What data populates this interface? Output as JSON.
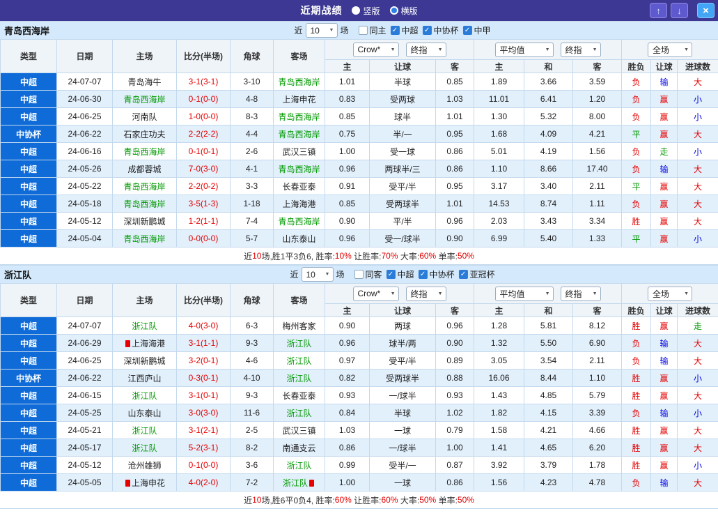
{
  "topbar": {
    "title": "近期战绩",
    "vertical_label": "竖版",
    "vertical_checked": false,
    "horizontal_label": "横版",
    "horizontal_checked": true,
    "up_icon": "↑",
    "down_icon": "↓",
    "close_icon": "×"
  },
  "filter_labels": {
    "near": "近",
    "count": "10",
    "games": "场"
  },
  "table_header": {
    "type": "类型",
    "date": "日期",
    "home": "主场",
    "score": "比分(半场)",
    "corner": "角球",
    "away": "客场",
    "bookmaker": "Crow*",
    "final_index_1": "终指",
    "average": "平均值",
    "final_index_2": "终指",
    "full_match": "全场",
    "sub": [
      "主",
      "让球",
      "客",
      "主",
      "和",
      "客",
      "胜负",
      "让球",
      "进球数"
    ]
  },
  "colors": {
    "topbar": "#3c3894",
    "league": "#0f6bd7",
    "alt": "#e2f0fc",
    "border": "#c3d9ed",
    "headbg": "#eff4f9",
    "section": "#d4e9fb",
    "red": "#e60000",
    "blue": "#0000e0",
    "green": "#009900"
  },
  "sections": [
    {
      "team": "青岛西海岸",
      "checkboxes": [
        {
          "label": "同主",
          "checked": false
        },
        {
          "label": "中超",
          "checked": true
        },
        {
          "label": "中协杯",
          "checked": true
        },
        {
          "label": "中甲",
          "checked": true
        }
      ],
      "rows": [
        {
          "lg": "中超",
          "dt": "24-07-07",
          "hm": "青岛海牛",
          "hg": false,
          "sc": "3-1(3-1)",
          "cn": "3-10",
          "aw": "青岛西海岸",
          "ag": true,
          "o": [
            "1.01",
            "半球",
            "0.85"
          ],
          "a": [
            "1.89",
            "3.66",
            "3.59"
          ],
          "r": [
            [
              "负",
              "red"
            ],
            [
              "输",
              "blue"
            ],
            [
              "大",
              "red"
            ]
          ]
        },
        {
          "lg": "中超",
          "dt": "24-06-30",
          "hm": "青岛西海岸",
          "hg": true,
          "sc": "0-1(0-0)",
          "cn": "4-8",
          "aw": "上海申花",
          "ag": false,
          "o": [
            "0.83",
            "受两球",
            "1.03"
          ],
          "a": [
            "11.01",
            "6.41",
            "1.20"
          ],
          "r": [
            [
              "负",
              "red"
            ],
            [
              "赢",
              "red"
            ],
            [
              "小",
              "blue"
            ]
          ]
        },
        {
          "lg": "中超",
          "dt": "24-06-25",
          "hm": "河南队",
          "hg": false,
          "sc": "1-0(0-0)",
          "cn": "8-3",
          "aw": "青岛西海岸",
          "ag": true,
          "o": [
            "0.85",
            "球半",
            "1.01"
          ],
          "a": [
            "1.30",
            "5.32",
            "8.00"
          ],
          "r": [
            [
              "负",
              "red"
            ],
            [
              "赢",
              "red"
            ],
            [
              "小",
              "blue"
            ]
          ]
        },
        {
          "lg": "中协杯",
          "dt": "24-06-22",
          "hm": "石家庄功夫",
          "hg": false,
          "sc": "2-2(2-2)",
          "cn": "4-4",
          "aw": "青岛西海岸",
          "ag": true,
          "o": [
            "0.75",
            "半/一",
            "0.95"
          ],
          "a": [
            "1.68",
            "4.09",
            "4.21"
          ],
          "r": [
            [
              "平",
              "green"
            ],
            [
              "赢",
              "red"
            ],
            [
              "大",
              "red"
            ]
          ]
        },
        {
          "lg": "中超",
          "dt": "24-06-16",
          "hm": "青岛西海岸",
          "hg": true,
          "sc": "0-1(0-1)",
          "cn": "2-6",
          "aw": "武汉三镇",
          "ag": false,
          "o": [
            "1.00",
            "受一球",
            "0.86"
          ],
          "a": [
            "5.01",
            "4.19",
            "1.56"
          ],
          "r": [
            [
              "负",
              "red"
            ],
            [
              "走",
              "green"
            ],
            [
              "小",
              "blue"
            ]
          ]
        },
        {
          "lg": "中超",
          "dt": "24-05-26",
          "hm": "成都蓉城",
          "hg": false,
          "sc": "7-0(3-0)",
          "cn": "4-1",
          "aw": "青岛西海岸",
          "ag": true,
          "o": [
            "0.96",
            "两球半/三",
            "0.86"
          ],
          "a": [
            "1.10",
            "8.66",
            "17.40"
          ],
          "r": [
            [
              "负",
              "red"
            ],
            [
              "输",
              "blue"
            ],
            [
              "大",
              "red"
            ]
          ]
        },
        {
          "lg": "中超",
          "dt": "24-05-22",
          "hm": "青岛西海岸",
          "hg": true,
          "sc": "2-2(0-2)",
          "cn": "3-3",
          "aw": "长春亚泰",
          "ag": false,
          "o": [
            "0.91",
            "受平/半",
            "0.95"
          ],
          "a": [
            "3.17",
            "3.40",
            "2.11"
          ],
          "r": [
            [
              "平",
              "green"
            ],
            [
              "赢",
              "red"
            ],
            [
              "大",
              "red"
            ]
          ]
        },
        {
          "lg": "中超",
          "dt": "24-05-18",
          "hm": "青岛西海岸",
          "hg": true,
          "sc": "3-5(1-3)",
          "cn": "1-18",
          "aw": "上海海港",
          "ag": false,
          "o": [
            "0.85",
            "受两球半",
            "1.01"
          ],
          "a": [
            "14.53",
            "8.74",
            "1.11"
          ],
          "r": [
            [
              "负",
              "red"
            ],
            [
              "赢",
              "red"
            ],
            [
              "大",
              "red"
            ]
          ]
        },
        {
          "lg": "中超",
          "dt": "24-05-12",
          "hm": "深圳新鹏城",
          "hg": false,
          "sc": "1-2(1-1)",
          "cn": "7-4",
          "aw": "青岛西海岸",
          "ag": true,
          "o": [
            "0.90",
            "平/半",
            "0.96"
          ],
          "a": [
            "2.03",
            "3.43",
            "3.34"
          ],
          "r": [
            [
              "胜",
              "red"
            ],
            [
              "赢",
              "red"
            ],
            [
              "大",
              "red"
            ]
          ]
        },
        {
          "lg": "中超",
          "dt": "24-05-04",
          "hm": "青岛西海岸",
          "hg": true,
          "sc": "0-0(0-0)",
          "cn": "5-7",
          "aw": "山东泰山",
          "ag": false,
          "o": [
            "0.96",
            "受一/球半",
            "0.90"
          ],
          "a": [
            "6.99",
            "5.40",
            "1.33"
          ],
          "r": [
            [
              "平",
              "green"
            ],
            [
              "赢",
              "red"
            ],
            [
              "小",
              "blue"
            ]
          ]
        }
      ],
      "summary": [
        {
          "t": "近"
        },
        {
          "t": "10",
          "c": "red"
        },
        {
          "t": "场,胜1平3负6, 胜率:"
        },
        {
          "t": "10%",
          "c": "red"
        },
        {
          "t": " 让胜率:"
        },
        {
          "t": "70%",
          "c": "red"
        },
        {
          "t": " 大率:"
        },
        {
          "t": "60%",
          "c": "red"
        },
        {
          "t": " 单率:"
        },
        {
          "t": "50%",
          "c": "red"
        }
      ]
    },
    {
      "team": "浙江队",
      "checkboxes": [
        {
          "label": "同客",
          "checked": false
        },
        {
          "label": "中超",
          "checked": true
        },
        {
          "label": "中协杯",
          "checked": true
        },
        {
          "label": "亚冠杯",
          "checked": true
        }
      ],
      "rows": [
        {
          "lg": "中超",
          "dt": "24-07-07",
          "hm": "浙江队",
          "hg": true,
          "sc": "4-0(3-0)",
          "cn": "6-3",
          "aw": "梅州客家",
          "ag": false,
          "o": [
            "0.90",
            "两球",
            "0.96"
          ],
          "a": [
            "1.28",
            "5.81",
            "8.12"
          ],
          "r": [
            [
              "胜",
              "red"
            ],
            [
              "赢",
              "red"
            ],
            [
              "走",
              "green"
            ]
          ]
        },
        {
          "lg": "中超",
          "dt": "24-06-29",
          "hm": "上海海港",
          "hg": false,
          "hc": true,
          "sc": "3-1(1-1)",
          "cn": "9-3",
          "aw": "浙江队",
          "ag": true,
          "o": [
            "0.96",
            "球半/两",
            "0.90"
          ],
          "a": [
            "1.32",
            "5.50",
            "6.90"
          ],
          "r": [
            [
              "负",
              "red"
            ],
            [
              "输",
              "blue"
            ],
            [
              "大",
              "red"
            ]
          ]
        },
        {
          "lg": "中超",
          "dt": "24-06-25",
          "hm": "深圳新鹏城",
          "hg": false,
          "sc": "3-2(0-1)",
          "cn": "4-6",
          "aw": "浙江队",
          "ag": true,
          "o": [
            "0.97",
            "受平/半",
            "0.89"
          ],
          "a": [
            "3.05",
            "3.54",
            "2.11"
          ],
          "r": [
            [
              "负",
              "red"
            ],
            [
              "输",
              "blue"
            ],
            [
              "大",
              "red"
            ]
          ]
        },
        {
          "lg": "中协杯",
          "dt": "24-06-22",
          "hm": "江西庐山",
          "hg": false,
          "sc": "0-3(0-1)",
          "cn": "4-10",
          "aw": "浙江队",
          "ag": true,
          "o": [
            "0.82",
            "受两球半",
            "0.88"
          ],
          "a": [
            "16.06",
            "8.44",
            "1.10"
          ],
          "r": [
            [
              "胜",
              "red"
            ],
            [
              "赢",
              "red"
            ],
            [
              "小",
              "blue"
            ]
          ]
        },
        {
          "lg": "中超",
          "dt": "24-06-15",
          "hm": "浙江队",
          "hg": true,
          "sc": "3-1(0-1)",
          "cn": "9-3",
          "aw": "长春亚泰",
          "ag": false,
          "o": [
            "0.93",
            "一/球半",
            "0.93"
          ],
          "a": [
            "1.43",
            "4.85",
            "5.79"
          ],
          "r": [
            [
              "胜",
              "red"
            ],
            [
              "赢",
              "red"
            ],
            [
              "大",
              "red"
            ]
          ]
        },
        {
          "lg": "中超",
          "dt": "24-05-25",
          "hm": "山东泰山",
          "hg": false,
          "sc": "3-0(3-0)",
          "cn": "11-6",
          "aw": "浙江队",
          "ag": true,
          "o": [
            "0.84",
            "半球",
            "1.02"
          ],
          "a": [
            "1.82",
            "4.15",
            "3.39"
          ],
          "r": [
            [
              "负",
              "red"
            ],
            [
              "输",
              "blue"
            ],
            [
              "小",
              "blue"
            ]
          ]
        },
        {
          "lg": "中超",
          "dt": "24-05-21",
          "hm": "浙江队",
          "hg": true,
          "sc": "3-1(2-1)",
          "cn": "2-5",
          "aw": "武汉三镇",
          "ag": false,
          "o": [
            "1.03",
            "一球",
            "0.79"
          ],
          "a": [
            "1.58",
            "4.21",
            "4.66"
          ],
          "r": [
            [
              "胜",
              "red"
            ],
            [
              "赢",
              "red"
            ],
            [
              "大",
              "red"
            ]
          ]
        },
        {
          "lg": "中超",
          "dt": "24-05-17",
          "hm": "浙江队",
          "hg": true,
          "sc": "5-2(3-1)",
          "cn": "8-2",
          "aw": "南通支云",
          "ag": false,
          "o": [
            "0.86",
            "一/球半",
            "1.00"
          ],
          "a": [
            "1.41",
            "4.65",
            "6.20"
          ],
          "r": [
            [
              "胜",
              "red"
            ],
            [
              "赢",
              "red"
            ],
            [
              "大",
              "red"
            ]
          ]
        },
        {
          "lg": "中超",
          "dt": "24-05-12",
          "hm": "沧州雄狮",
          "hg": false,
          "sc": "0-1(0-0)",
          "cn": "3-6",
          "aw": "浙江队",
          "ag": true,
          "o": [
            "0.99",
            "受半/一",
            "0.87"
          ],
          "a": [
            "3.92",
            "3.79",
            "1.78"
          ],
          "r": [
            [
              "胜",
              "red"
            ],
            [
              "赢",
              "red"
            ],
            [
              "小",
              "blue"
            ]
          ]
        },
        {
          "lg": "中超",
          "dt": "24-05-05",
          "hm": "上海申花",
          "hg": false,
          "hc": true,
          "sc": "4-0(2-0)",
          "cn": "7-2",
          "aw": "浙江队",
          "ag": true,
          "ac": true,
          "o": [
            "1.00",
            "一球",
            "0.86"
          ],
          "a": [
            "1.56",
            "4.23",
            "4.78"
          ],
          "r": [
            [
              "负",
              "red"
            ],
            [
              "输",
              "blue"
            ],
            [
              "大",
              "red"
            ]
          ]
        }
      ],
      "summary": [
        {
          "t": "近"
        },
        {
          "t": "10",
          "c": "red"
        },
        {
          "t": "场,胜6平0负4, 胜率:"
        },
        {
          "t": "60%",
          "c": "red"
        },
        {
          "t": " 让胜率:"
        },
        {
          "t": "60%",
          "c": "red"
        },
        {
          "t": " 大率:"
        },
        {
          "t": "50%",
          "c": "red"
        },
        {
          "t": " 单率:"
        },
        {
          "t": "50%",
          "c": "red"
        }
      ]
    }
  ]
}
